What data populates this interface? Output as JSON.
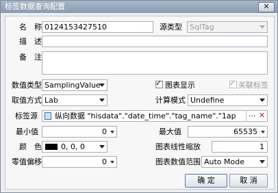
{
  "window": {
    "title": "标签数据查询配置",
    "close_glyph": "✕"
  },
  "form": {
    "name_label": "名　称",
    "name_value": "0124153427510",
    "source_type_label": "源类型",
    "source_type_value": "SqlTag",
    "desc_label": "描　述",
    "desc_value": "",
    "remark_label": "备　注",
    "remark_value": "",
    "value_type_label": "数值类型",
    "value_type_value": "SamplingValue",
    "chart_display_label": "图表显示",
    "chart_display_checked": true,
    "related_tag_label": "关联标签",
    "related_tag_checked": true,
    "method_label": "取值方式",
    "method_value": "Lab",
    "calc_mode_label": "计算模式",
    "calc_mode_value": "Undefine",
    "tag_source_label": "标签源",
    "tag_source_value": "纵向数据 \"hisdata\".\"date_time\".\"tag_name\".\"1ap",
    "tag_source_more": "···",
    "tag_source_clear": "✕",
    "min_label": "最小值",
    "min_value": "0",
    "max_label": "最大值",
    "max_value": "65535",
    "color_label": "颜　色",
    "color_value": "0, 0, 0",
    "color_hex": "#000000",
    "linear_scale_label": "图表线性缩放",
    "linear_scale_value": "1",
    "zero_offset_label": "零值偏移",
    "zero_offset_value": "0",
    "value_range_label": "图表数值范围",
    "value_range_value": "Auto Mode"
  },
  "buttons": {
    "ok": "确 定",
    "cancel": "取 消"
  },
  "icons": {
    "check": "✓"
  }
}
